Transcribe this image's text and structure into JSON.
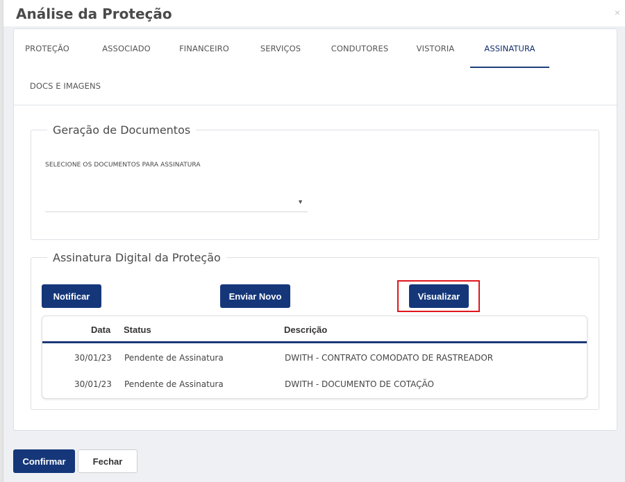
{
  "modal": {
    "title": "Análise da Proteção",
    "close_glyph": "×"
  },
  "tabs": [
    {
      "label": "PROTEÇÃO",
      "active": false
    },
    {
      "label": "ASSOCIADO",
      "active": false
    },
    {
      "label": "FINANCEIRO",
      "active": false
    },
    {
      "label": "SERVIÇOS",
      "active": false
    },
    {
      "label": "CONDUTORES",
      "active": false
    },
    {
      "label": "VISTORIA",
      "active": false
    },
    {
      "label": "ASSINATURA",
      "active": true
    },
    {
      "label": "DOCS E IMAGENS",
      "active": false
    }
  ],
  "documents": {
    "legend": "Geração de Documentos",
    "select_label": "SELECIONE OS DOCUMENTOS PARA ASSINATURA",
    "select_value": "",
    "arrow_glyph": "▼"
  },
  "signature": {
    "legend": "Assinatura Digital da Proteção",
    "buttons": {
      "notify": "Notificar",
      "resend": "Enviar Novo",
      "view": "Visualizar"
    },
    "table": {
      "headers": {
        "date": "Data",
        "status": "Status",
        "description": "Descrição"
      },
      "rows": [
        {
          "date": "30/01/23",
          "status": "Pendente de Assinatura",
          "description": "DWITH - CONTRATO COMODATO DE RASTREADOR"
        },
        {
          "date": "30/01/23",
          "status": "Pendente de Assinatura",
          "description": "DWITH - DOCUMENTO DE COTAÇÃO"
        }
      ]
    }
  },
  "footer": {
    "confirm": "Confirmar",
    "close": "Fechar"
  },
  "colors": {
    "primary": "#15377a",
    "highlight": "#e0161c",
    "tab_underline": "#1f3d7a"
  }
}
